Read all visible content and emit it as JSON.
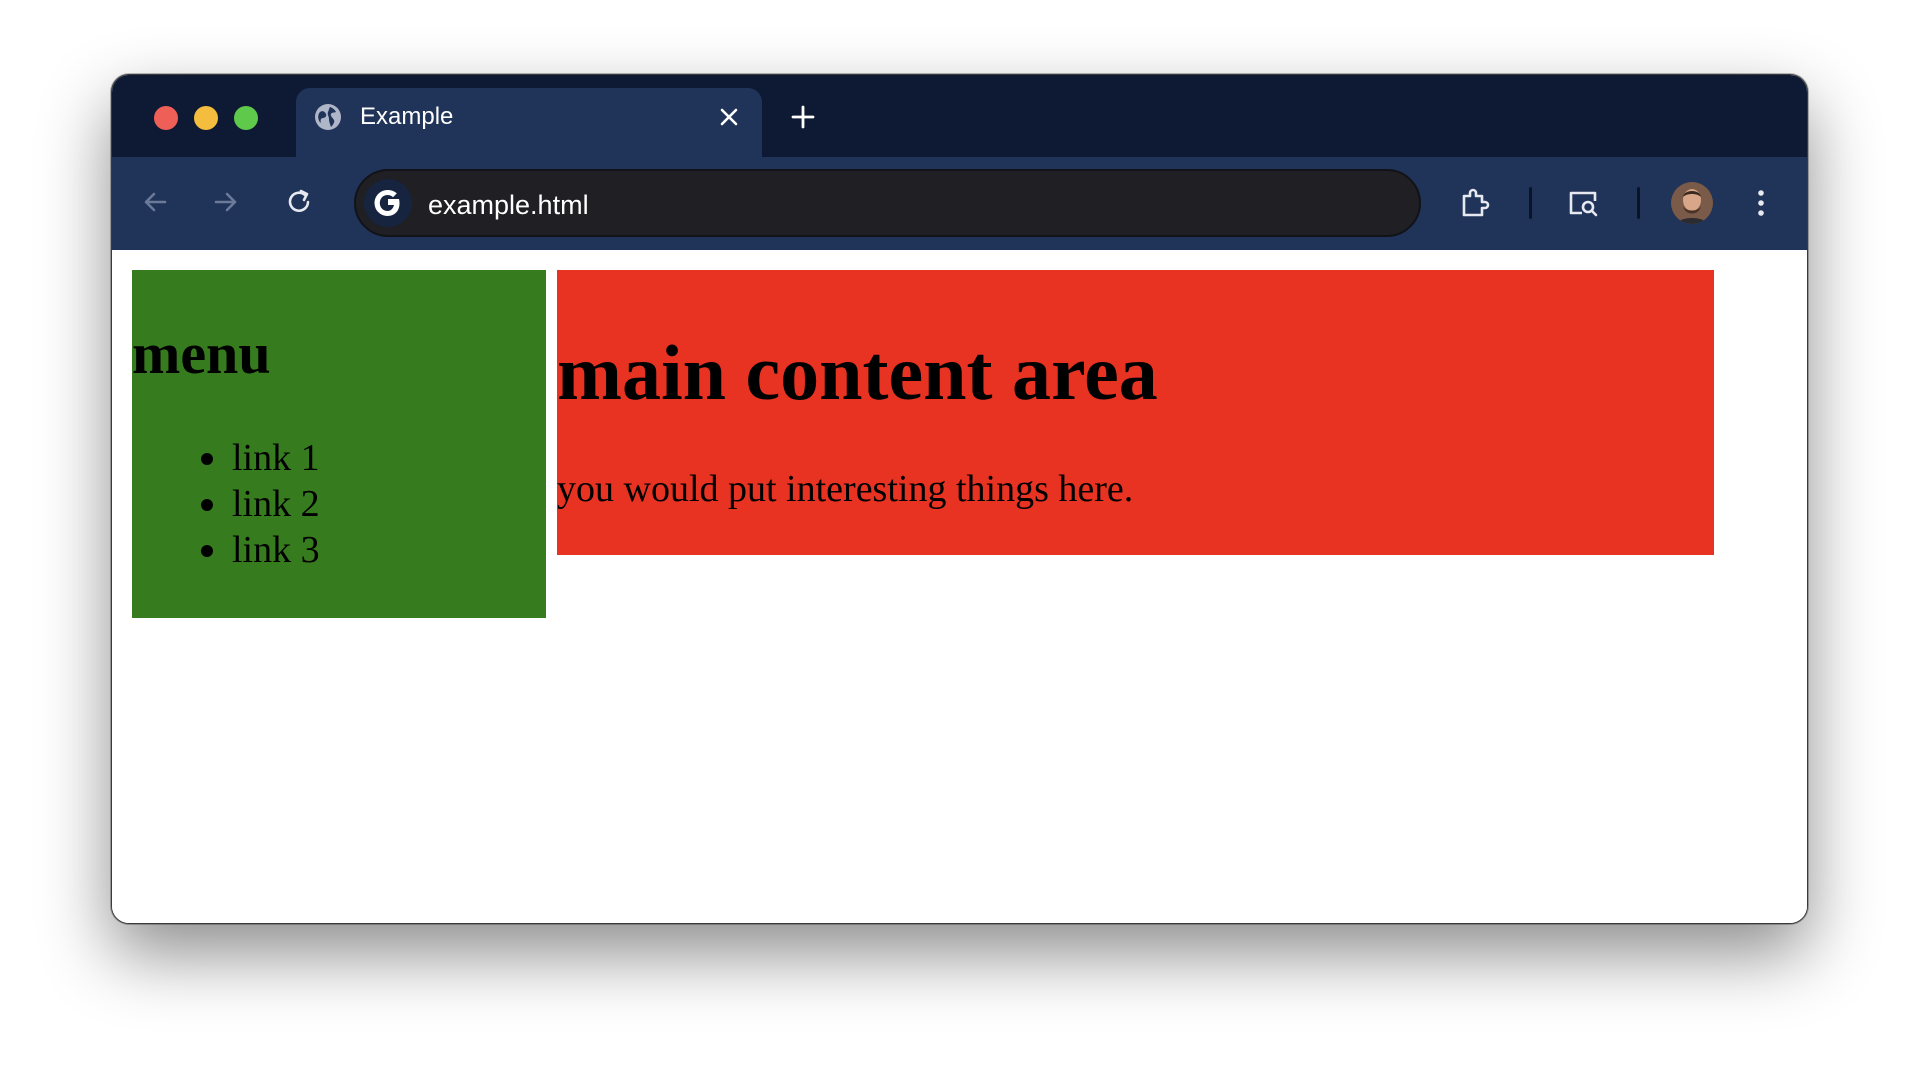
{
  "browser": {
    "tab": {
      "title": "Example"
    },
    "address_bar": {
      "url": "example.html"
    },
    "icons": [
      "globe-icon",
      "close-icon",
      "plus-icon",
      "back-arrow-icon",
      "forward-arrow-icon",
      "reload-icon",
      "google-icon",
      "extensions-icon",
      "lens-search-icon",
      "avatar",
      "more-vert-icon"
    ],
    "colors": {
      "tab_strip": "#0e1a33",
      "toolbar": "#203358",
      "omnibox": "#1f1f24"
    }
  },
  "page": {
    "menu": {
      "heading": "menu",
      "links": [
        "link 1",
        "link 2",
        "link 3"
      ],
      "background": "#367c1f"
    },
    "main": {
      "heading": "main content area",
      "body": "you would put interesting things here.",
      "background": "#e83323"
    }
  }
}
